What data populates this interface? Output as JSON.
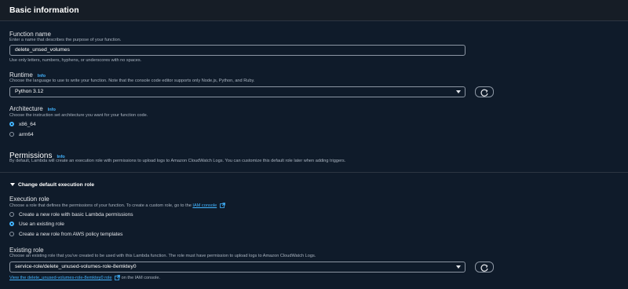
{
  "basic": {
    "title": "Basic information",
    "function_name": {
      "label": "Function name",
      "description": "Enter a name that describes the purpose of your function.",
      "value": "delete_unsed_volumes",
      "constraint": "Use only letters, numbers, hyphens, or underscores with no spaces."
    },
    "runtime": {
      "label": "Runtime",
      "info": "Info",
      "description": "Choose the language to use to write your function. Note that the console code editor supports only Node.js, Python, and Ruby.",
      "selected": "Python 3.12"
    },
    "architecture": {
      "label": "Architecture",
      "info": "Info",
      "description": "Choose the instruction set architecture you want for your function code.",
      "options": [
        {
          "label": "x86_64",
          "checked": true
        },
        {
          "label": "arm64",
          "checked": false
        }
      ]
    }
  },
  "permissions": {
    "title": "Permissions",
    "info": "Info",
    "description": "By default, Lambda will create an execution role with permissions to upload logs to Amazon CloudWatch Logs. You can customize this default role later when adding triggers.",
    "expander_label": "Change default execution role",
    "execution_role": {
      "label": "Execution role",
      "description_prefix": "Choose a role that defines the permissions of your function. To create a custom role, go to the",
      "link": "IAM console",
      "options": [
        {
          "label": "Create a new role with basic Lambda permissions",
          "checked": false
        },
        {
          "label": "Use an existing role",
          "checked": true
        },
        {
          "label": "Create a new role from AWS policy templates",
          "checked": false
        }
      ]
    },
    "existing_role": {
      "label": "Existing role",
      "description": "Choose an existing role that you've created to be used with this Lambda function. The role must have permission to upload logs to Amazon CloudWatch Logs.",
      "selected": "service-role/delete_unused-volumes-role-8emktey0",
      "view_link": "View the delete_unused-volumes-role-8emktey0 role",
      "view_suffix": "on the IAM console."
    }
  },
  "colors": {
    "background": "#0f1b2a",
    "accent": "#42b4ff",
    "header": "#161d26"
  },
  "icons": [
    "refresh-icon",
    "caret-down-icon",
    "external-link-icon",
    "triangle-down-icon"
  ]
}
